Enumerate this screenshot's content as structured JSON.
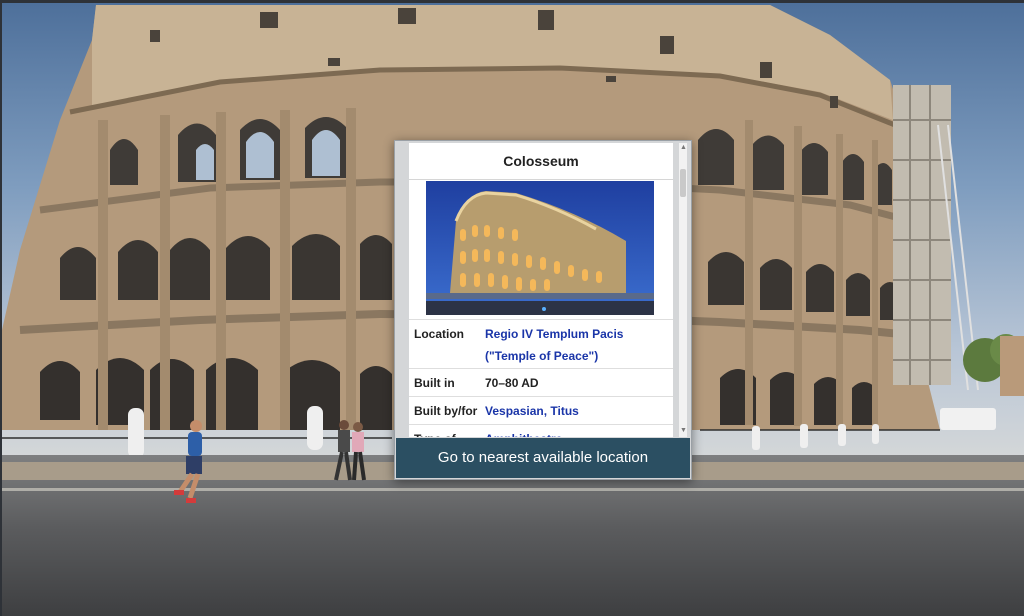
{
  "info_card": {
    "title": "Colosseum",
    "rows": [
      {
        "key": "Location",
        "value": "Regio IV Templum Pacis (\"Temple of Peace\")"
      },
      {
        "key": "Built in",
        "value": "70–80 AD"
      },
      {
        "key": "Built by/for",
        "value": "Vespasian, Titus"
      },
      {
        "key": "Type of",
        "value": "Amphitheatre"
      }
    ],
    "button_label": "Go to nearest available location"
  },
  "colors": {
    "button_bg": "#2b4f62",
    "link_text": "#1a35a8",
    "stone": "#b9a184"
  }
}
